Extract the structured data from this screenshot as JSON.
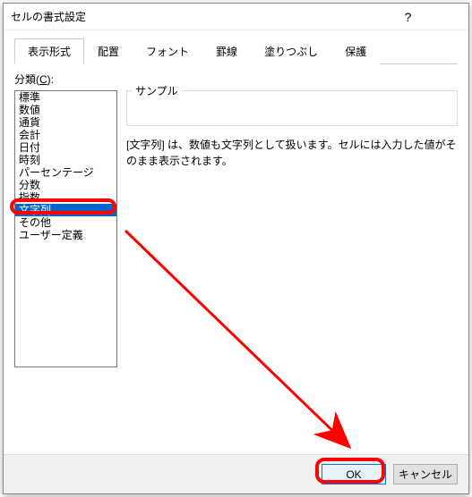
{
  "window": {
    "title": "セルの書式設定"
  },
  "tabs": [
    {
      "label": "表示形式",
      "active": true
    },
    {
      "label": "配置"
    },
    {
      "label": "フォント"
    },
    {
      "label": "罫線"
    },
    {
      "label": "塗りつぶし"
    },
    {
      "label": "保護"
    }
  ],
  "category": {
    "label_prefix": "分類(",
    "label_key": "C",
    "label_suffix": "):",
    "items": [
      "標準",
      "数値",
      "通貨",
      "会計",
      "日付",
      "時刻",
      "パーセンテージ",
      "分数",
      "指数",
      "文字列",
      "その他",
      "ユーザー定義"
    ],
    "selected_index": 9
  },
  "sample": {
    "label": "サンプル",
    "value": ""
  },
  "description": "[文字列] は、数値も文字列として扱います。セルには入力した値がそのまま表示されます。",
  "buttons": {
    "ok": "OK",
    "cancel": "キャンセル"
  },
  "colors": {
    "highlight": "#ff0000",
    "selection": "#0a64c8"
  }
}
